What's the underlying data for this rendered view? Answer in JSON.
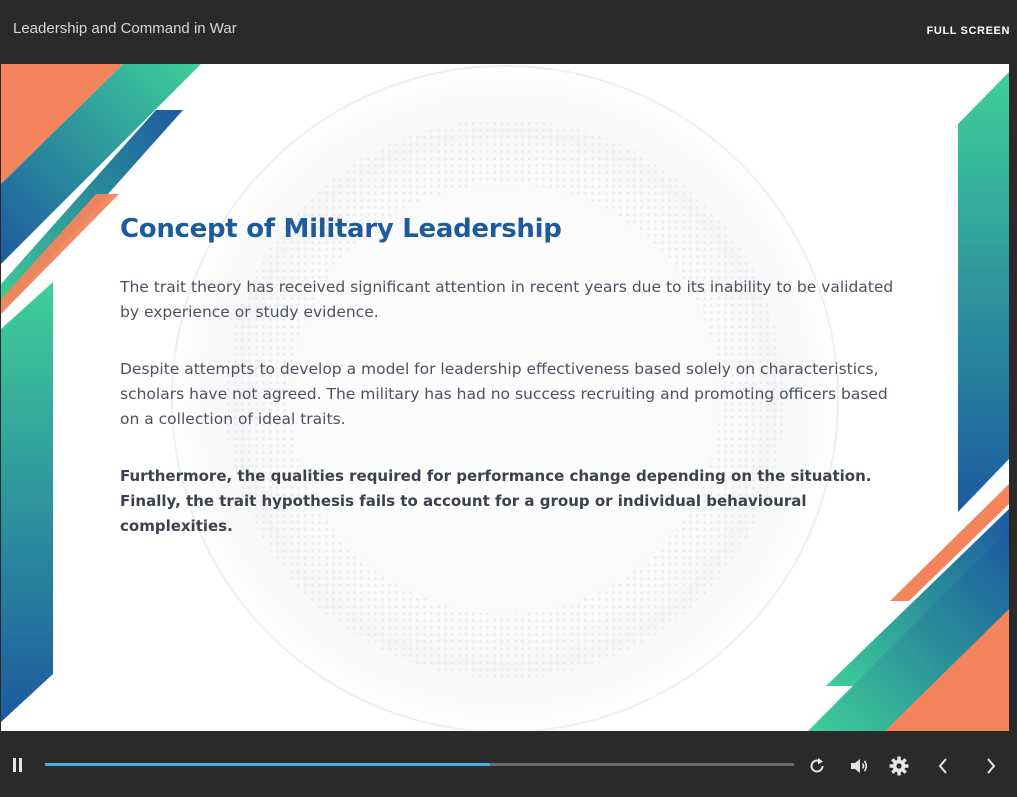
{
  "header": {
    "title": "Leadership and Command in War",
    "fullscreen_label": "FULL SCREEN"
  },
  "slide": {
    "heading": "Concept of Military Leadership",
    "paragraphs": [
      "The trait theory has received significant attention in recent years due to its inability to be validated by experience or study evidence.",
      "Despite attempts to develop a model for leadership effectiveness based solely on characteristics, scholars have not agreed. The military has had no success recruiting and promoting officers based on a collection of ideal traits.",
      "Furthermore, the qualities required for performance change depending on the situation. Finally, the trait hypothesis fails to account for a group or individual behavioural complexities."
    ],
    "colors": {
      "heading": "#1d5b9c",
      "orange": "#f3845c",
      "teal": "#3fcf9a",
      "blue": "#1c5aa0"
    }
  },
  "player": {
    "progress_fraction": 0.594,
    "icons": [
      "pause-icon",
      "replay-icon",
      "volume-icon",
      "settings-icon",
      "previous-icon",
      "next-icon"
    ],
    "progress_color": "#48a9e6"
  }
}
